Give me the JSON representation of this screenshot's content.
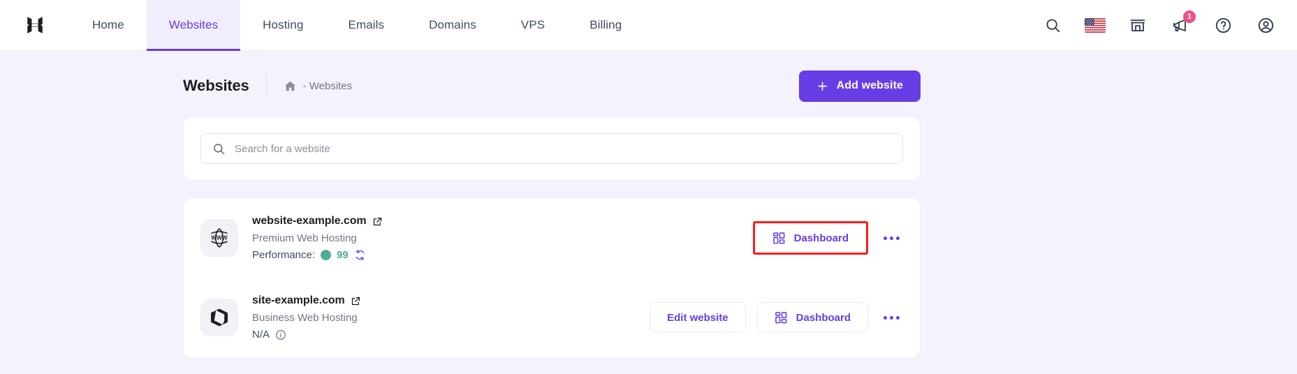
{
  "brand": {
    "logo_alt": "hostinger-logo",
    "accent": "#673de6"
  },
  "topnav": {
    "items": [
      {
        "label": "Home",
        "active": false
      },
      {
        "label": "Websites",
        "active": true
      },
      {
        "label": "Hosting",
        "active": false
      },
      {
        "label": "Emails",
        "active": false
      },
      {
        "label": "Domains",
        "active": false
      },
      {
        "label": "VPS",
        "active": false
      },
      {
        "label": "Billing",
        "active": false
      }
    ],
    "icons": [
      {
        "name": "search-icon",
        "glyph": "search"
      },
      {
        "name": "language-flag-icon",
        "glyph": "us-flag"
      },
      {
        "name": "store-icon",
        "glyph": "store"
      },
      {
        "name": "announcements-icon",
        "glyph": "megaphone",
        "badge": "1"
      },
      {
        "name": "help-icon",
        "glyph": "question-circle"
      },
      {
        "name": "account-icon",
        "glyph": "user-circle"
      }
    ],
    "badge_color": "#f0518d"
  },
  "header": {
    "title": "Websites",
    "breadcrumb_home_icon": "home-icon",
    "breadcrumb_text": "- Websites",
    "add_button_label": "Add website",
    "add_button_icon": "plus-icon"
  },
  "search": {
    "placeholder": "Search for a website",
    "value": "",
    "icon": "search-icon"
  },
  "websites": [
    {
      "avatar_icon": "www-globe-icon",
      "name": "website-example.com",
      "external_link_icon": "external-link-icon",
      "plan": "Premium Web Hosting",
      "metric_label": "Performance:",
      "metric_value": "99",
      "metric_color": "#4fac95",
      "metric_refresh_icon": "refresh-icon",
      "metric_type": "performance",
      "edit_button_label": null,
      "dashboard_button_label": "Dashboard",
      "dashboard_icon": "grid-dashboard-icon",
      "dashboard_highlighted": true,
      "menu_icon": "more-options-icon"
    },
    {
      "avatar_icon": "cube-site-icon",
      "name": "site-example.com",
      "external_link_icon": "external-link-icon",
      "plan": "Business Web Hosting",
      "metric_label": "",
      "metric_value": "N/A",
      "metric_color": "#404b63",
      "metric_info_icon": "info-icon",
      "metric_type": "na",
      "edit_button_label": "Edit website",
      "dashboard_button_label": "Dashboard",
      "dashboard_icon": "grid-dashboard-icon",
      "dashboard_highlighted": false,
      "menu_icon": "more-options-icon"
    }
  ],
  "annotation": {
    "highlight_color": "#fc1d1d",
    "target": "dashboard-button-row-1"
  }
}
